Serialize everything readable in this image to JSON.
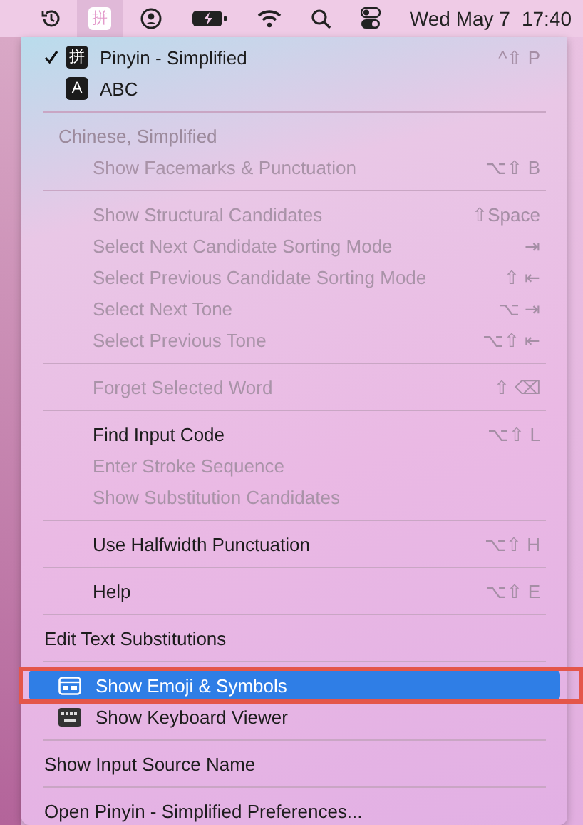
{
  "menu_bar": {
    "input_icon_text": "拼",
    "date": "Wed May 7",
    "time": "17:40"
  },
  "menu": {
    "items": [
      {
        "kind": "item",
        "label": "Pinyin - Simplified",
        "icon_text": "拼",
        "checked": true,
        "disabled": false,
        "selected": false,
        "shortcut": "^⇧ P"
      },
      {
        "kind": "item",
        "label": "ABC",
        "icon_text": "A",
        "checked": false,
        "disabled": false,
        "selected": false
      },
      {
        "kind": "separator"
      },
      {
        "kind": "header",
        "label": "Chinese, Simplified",
        "children": [
          {
            "kind": "item",
            "label": "Show Facemarks & Punctuation",
            "disabled": true,
            "selected": false,
            "shortcut": "⌥⇧ B"
          },
          {
            "kind": "separator"
          },
          {
            "kind": "item",
            "label": "Show Structural Candidates",
            "disabled": true,
            "selected": false,
            "shortcut": "⇧Space"
          },
          {
            "kind": "item",
            "label": "Select Next Candidate Sorting Mode",
            "disabled": true,
            "selected": false,
            "shortcut": "⇥"
          },
          {
            "kind": "item",
            "label": "Select Previous Candidate Sorting Mode",
            "disabled": true,
            "selected": false,
            "shortcut": "⇧ ⇤"
          },
          {
            "kind": "item",
            "label": "Select Next Tone",
            "disabled": true,
            "selected": false,
            "shortcut": "⌥ ⇥"
          },
          {
            "kind": "item",
            "label": "Select Previous Tone",
            "disabled": true,
            "selected": false,
            "shortcut": "⌥⇧ ⇤"
          },
          {
            "kind": "separator"
          },
          {
            "kind": "item",
            "label": "Forget Selected Word",
            "disabled": true,
            "selected": false,
            "shortcut": "⇧ ⌫"
          },
          {
            "kind": "separator"
          },
          {
            "kind": "item",
            "label": "Find Input Code",
            "disabled": false,
            "selected": false,
            "shortcut": "⌥⇧ L"
          },
          {
            "kind": "item",
            "label": "Enter Stroke Sequence",
            "disabled": true,
            "selected": false
          },
          {
            "kind": "item",
            "label": "Show Substitution Candidates",
            "disabled": true,
            "selected": false
          },
          {
            "kind": "separator"
          },
          {
            "kind": "item",
            "label": "Use Halfwidth Punctuation",
            "disabled": false,
            "selected": false,
            "shortcut": "⌥⇧ H"
          },
          {
            "kind": "separator"
          },
          {
            "kind": "item",
            "label": "Help",
            "disabled": false,
            "selected": false,
            "shortcut": "⌥⇧ E"
          }
        ]
      },
      {
        "kind": "separator"
      },
      {
        "kind": "item",
        "label": "Edit Text Substitutions",
        "disabled": false,
        "selected": false
      },
      {
        "kind": "separator"
      },
      {
        "kind": "window_item",
        "label": "Show Emoji & Symbols",
        "disabled": false,
        "selected": true,
        "annotated": true
      },
      {
        "kind": "keyboard_item",
        "label": "Show Keyboard Viewer",
        "disabled": false,
        "selected": false
      },
      {
        "kind": "separator"
      },
      {
        "kind": "item",
        "label": "Show Input Source Name",
        "disabled": false,
        "selected": false
      },
      {
        "kind": "separator"
      },
      {
        "kind": "item",
        "label": "Open Pinyin - Simplified Preferences...",
        "disabled": false,
        "selected": false
      }
    ]
  }
}
